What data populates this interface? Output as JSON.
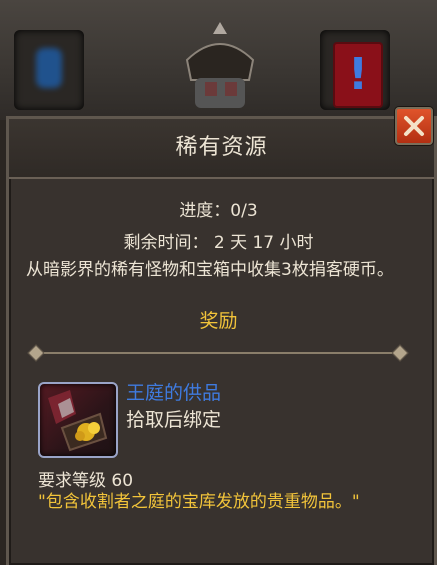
{
  "panel": {
    "title": "稀有资源",
    "progress": "进度：0/3",
    "time_remaining": "剩余时间： 2 天 17 小时",
    "description": "从暗影界的稀有怪物和宝箱中收集3枚捐客硬币。",
    "rewards_header": "奖励"
  },
  "reward_item": {
    "name": "王庭的供品",
    "bind": "拾取后绑定",
    "required_level": "要求等级 60",
    "flavor": "\"包含收割者之庭的宝库发放的贵重物品。\"",
    "name_color": "#3f7be0"
  },
  "colors": {
    "title_text": "#ece4d4",
    "gold": "#f2c43a",
    "close_button": "#c43a1a"
  },
  "icons": {
    "close": "close-x-icon",
    "item": "offering-chest-icon"
  }
}
